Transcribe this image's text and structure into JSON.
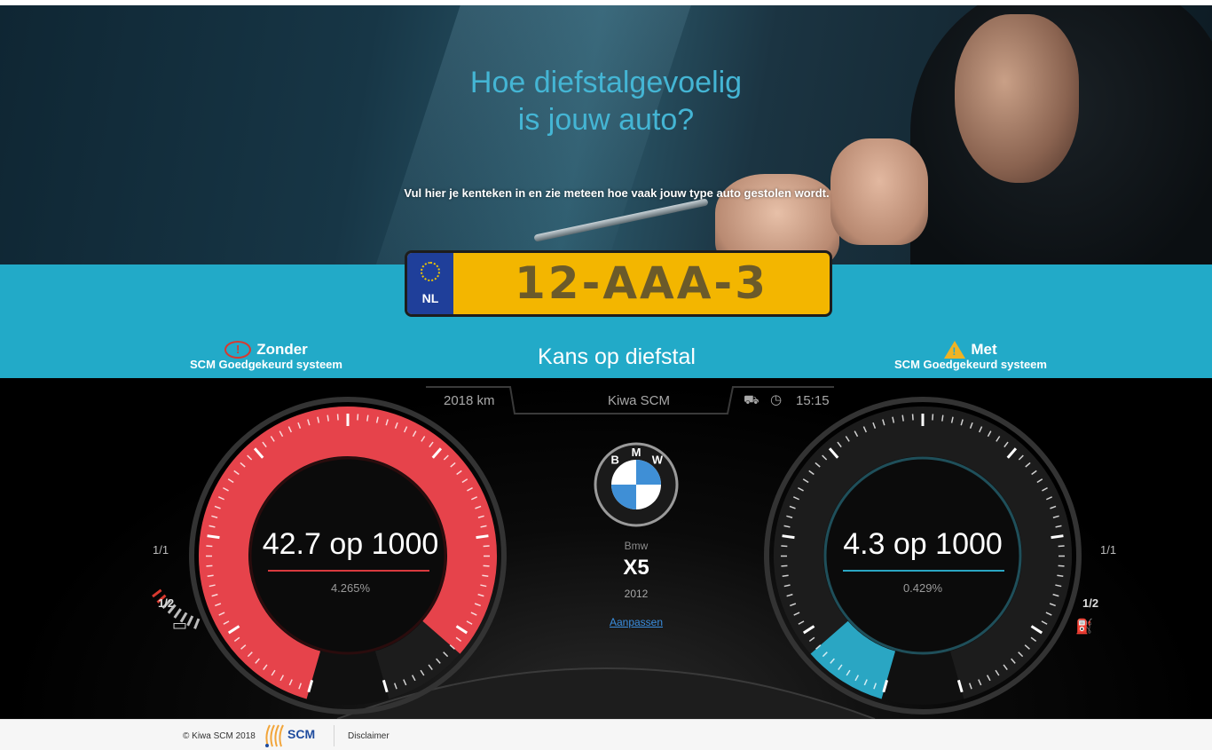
{
  "hero": {
    "title_line1": "Hoe diefstalgevoelig",
    "title_line2": "is jouw auto?",
    "subtitle": "Vul hier je kenteken in en zie meteen hoe vaak jouw type auto gestolen wordt."
  },
  "plate": {
    "country": "NL",
    "number": "12-AAA-3"
  },
  "band": {
    "left_title": "Zonder",
    "left_subtitle": "SCM Goedgekeurd systeem",
    "center_title": "Kans op diefstal",
    "right_title": "Met",
    "right_subtitle": "SCM Goedgekeurd systeem",
    "colors": {
      "band": "#22aac8",
      "warn_red": "#d9392f",
      "warn_yellow": "#f0b323"
    }
  },
  "dash": {
    "topbar": {
      "distance": "2018 km",
      "center": "Kiwa SCM",
      "time": "15:15"
    },
    "left_gauge": {
      "value_text": "42.7 op 1000",
      "percent_text": "4.265%",
      "fill_fraction": 0.9,
      "color": "#e6434b",
      "side_labels": [
        "1/1",
        "1/2"
      ]
    },
    "right_gauge": {
      "value_text": "4.3 op 1000",
      "percent_text": "0.429%",
      "fill_fraction": 0.1,
      "color": "#2aa6c3",
      "side_labels": [
        "1/1",
        "1/2"
      ]
    },
    "car": {
      "brand_logo_text": "BMW",
      "make": "Bmw",
      "model": "X5",
      "year": "2012",
      "edit_link": "Aanpassen"
    }
  },
  "footer": {
    "copyright": "© Kiwa SCM 2018",
    "logo_text": "SCM",
    "disclaimer": "Disclaimer"
  }
}
